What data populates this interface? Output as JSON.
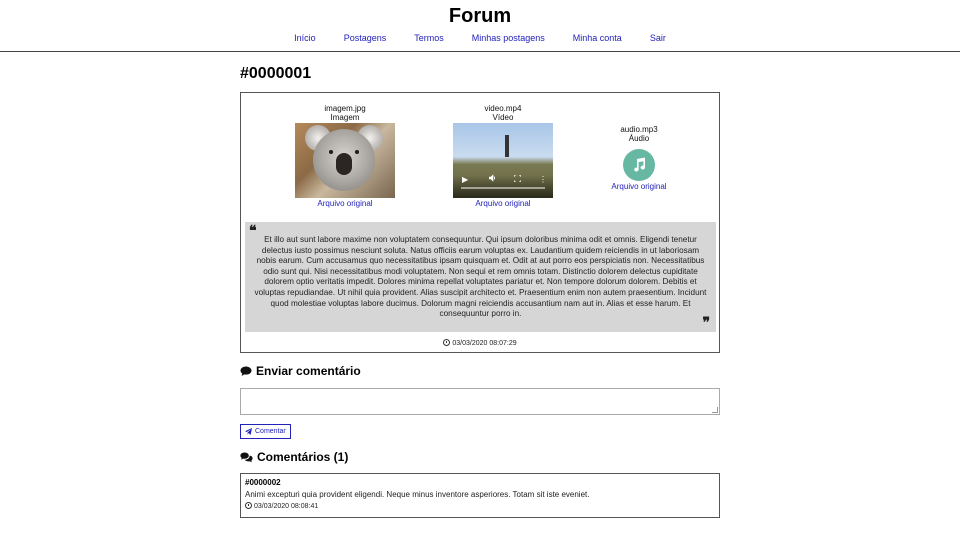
{
  "header": {
    "title": "Forum",
    "nav": [
      "Início",
      "Postagens",
      "Termos",
      "Minhas postagens",
      "Minha conta",
      "Sair"
    ]
  },
  "post": {
    "id": "#0000001",
    "attachments": [
      {
        "filename": "imagem.jpg",
        "type": "Imagem",
        "link": "Arquivo original"
      },
      {
        "filename": "video.mp4",
        "type": "Vídeo",
        "link": "Arquivo original"
      },
      {
        "filename": "audio.mp3",
        "type": "Áudio",
        "link": "Arquivo original"
      }
    ],
    "body": "Et illo aut sunt labore maxime non voluptatem consequuntur. Qui ipsum doloribus minima odit et omnis. Eligendi tenetur delectus iusto possimus nesciunt soluta. Natus officiis earum voluptas ex. Laudantium quidem reiciendis in ut laboriosam nobis earum. Cum accusamus quo necessitatibus ipsam quisquam et. Odit at aut porro eos perspiciatis non. Necessitatibus odio sunt qui. Nisi necessitatibus modi voluptatem. Non sequi et rem omnis totam. Distinctio dolorem delectus cupiditate dolorem optio veritatis impedit. Dolores minima repellat voluptates pariatur et. Non tempore dolorum dolorem. Debitis et voluptas repudiandae. Ut nihil quia provident. Alias suscipit architecto et. Praesentium enim non autem praesentium. Incidunt quod molestiae voluptas labore ducimus. Dolorum magni reiciendis accusantium nam aut in. Alias et esse harum. Et consequuntur porro in.",
    "date": "03/03/2020 08:07:29"
  },
  "comment_form": {
    "heading": "Enviar comentário",
    "textarea_value": "",
    "button_label": "Comentar"
  },
  "comments": {
    "heading": "Comentários (1)",
    "items": [
      {
        "id": "#0000002",
        "text": "Animi excepturi quia provident eligendi. Neque minus inventore asperiores. Totam sit iste eveniet.",
        "date": "03/03/2020 08:08:41"
      }
    ]
  },
  "colors": {
    "link": "#2222bb",
    "quote_background": "#d6d6d6",
    "audio_icon": "#66b8a3",
    "border": "#555555"
  },
  "icons": {
    "audio": "music-note-icon",
    "date": "clock-icon",
    "send_heading": "comment-icon",
    "comments_heading": "comments-icon",
    "button": "paper-plane-icon",
    "quote": "quote-icon"
  }
}
